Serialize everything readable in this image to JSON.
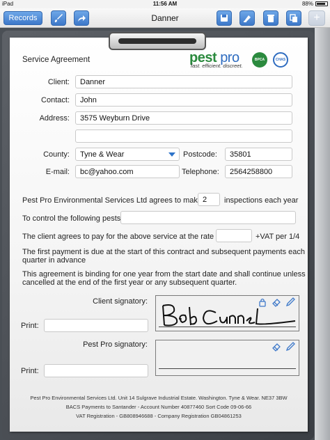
{
  "status": {
    "device": "iPad",
    "time": "11:56 AM",
    "battery": "88%",
    "battery_level": 0.88
  },
  "toolbar": {
    "records_label": "Records",
    "title": "Danner",
    "add_label": "+"
  },
  "form": {
    "heading": "Service Agreement",
    "logo": {
      "word1": "pest",
      "word2": "pro",
      "tagline": "fast. efficient. discreet.",
      "badge1": "BPCA",
      "badge2": "CHAS"
    },
    "client_label": "Client:",
    "client_value": "Danner",
    "contact_label": "Contact:",
    "contact_value": "John",
    "address_label": "Address:",
    "address_line1": "3575 Weyburn Drive",
    "address_line2": "",
    "county_label": "County:",
    "county_value": "Tyne & Wear",
    "postcode_label": "Postcode:",
    "postcode_value": "35801",
    "email_label": "E-mail:",
    "email_value": "bc@yahoo.com",
    "telephone_label": "Telephone:",
    "telephone_value": "2564258800",
    "inspections_text_before": "Pest Pro Environmental Services Ltd agrees to make",
    "inspections_value": "2",
    "inspections_text_after": "inspections each year",
    "pests_label": "To control the following pests",
    "pests_value": "",
    "rate_text_before": "The client agrees to pay for the above service at the rate of",
    "rate_value": "",
    "rate_text_after": "+VAT per 1/4",
    "payment_line1": "The first payment is due at the start of this contract and subsequent payments each",
    "payment_line2": "quarter in advance",
    "binding_line1": "This agreement is binding for one year from the start date and shall continue unless",
    "binding_line2": "cancelled at the end of the first year or any subsequent quarter.",
    "client_signatory_label": "Client signatory:",
    "client_signature": "Bob Cunnel",
    "print_label_1": "Print:",
    "print_value_1": "",
    "pestpro_signatory_label": "Pest Pro signatory:",
    "print_label_2": "Print:",
    "print_value_2": ""
  },
  "footer": {
    "line1": "Pest Pro Environmental Services Ltd. Unit 14 Sulgrave Industrial Estate. Washington. Tyne & Wear. NE37 3BW",
    "line2": "BACS Payments to Santander - Account Number 40877460 Sort Code 09-06-66",
    "line3": "VAT Registration - GB808946688 - Company Registration GB04861253"
  },
  "colors": {
    "accent": "#3d78c9",
    "logo_green": "#2b8a3e",
    "logo_blue": "#2e6cc0"
  },
  "icons": [
    "brush-icon",
    "share-icon",
    "save-icon",
    "stamp-icon",
    "trash-icon",
    "copy-icon",
    "add-icon",
    "lock-icon",
    "eraser-icon",
    "pen-icon"
  ]
}
